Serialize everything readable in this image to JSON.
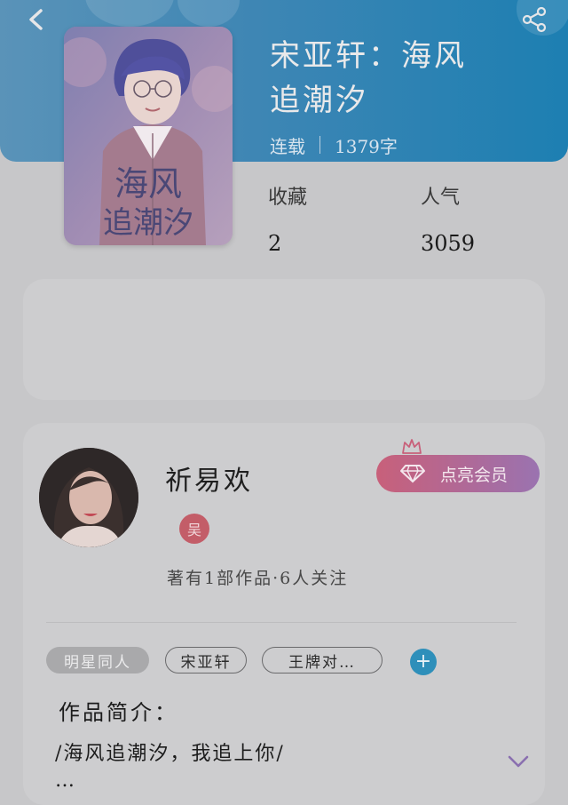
{
  "book": {
    "title_line1": "宋亚轩：海风",
    "title_line2": "追潮汐",
    "status": "连载",
    "word_count": "1379字",
    "stats": {
      "favorites_label": "收藏",
      "favorites_value": "2",
      "popularity_label": "人气",
      "popularity_value": "3059"
    },
    "cover_text": "海风追潮汐"
  },
  "author": {
    "name": "祈易欢",
    "level_badge": "吴",
    "vip_button_label": "点亮会员",
    "stats_line": "著有1部作品·6人关注"
  },
  "tags": [
    "明星同人",
    "宋亚轩",
    "王牌对…"
  ],
  "intro": {
    "heading": "作品简介：",
    "text_line1": "/海风追潮汐，我追上你/",
    "text_line2": "…"
  },
  "icons": {
    "back": "back-arrow-icon",
    "share": "share-icon",
    "add_tag": "plus-icon",
    "expand": "chevron-down-icon",
    "vip": "diamond-icon",
    "crown": "crown-icon"
  },
  "colors": {
    "header_start": "#5a93b8",
    "header_end": "#1d7fb2",
    "vip_start": "#c8607a",
    "vip_end": "#9a73b0",
    "accent_blue": "#2e8fba"
  }
}
